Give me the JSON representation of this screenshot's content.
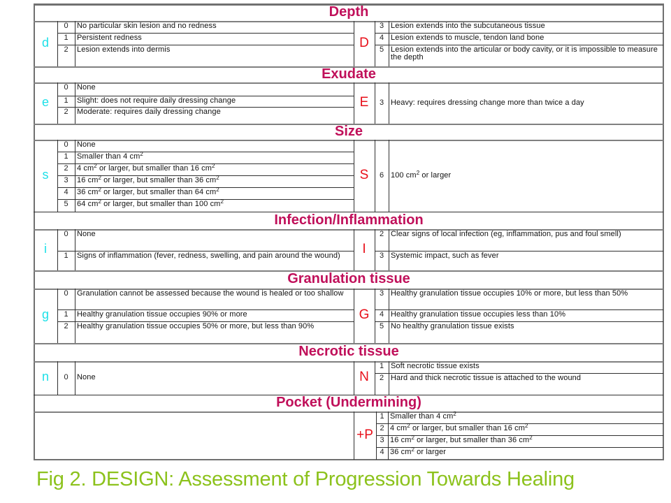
{
  "sections": {
    "depth": {
      "title": "Depth",
      "low_letter": "d",
      "high_letter": "D",
      "low_items": [
        {
          "score": "0",
          "text": "No particular skin lesion and no redness"
        },
        {
          "score": "1",
          "text": "Persistent redness"
        },
        {
          "score": "2",
          "text": "Lesion extends into dermis"
        }
      ],
      "high_items": [
        {
          "score": "3",
          "text": "Lesion extends into the subcutaneous tissue"
        },
        {
          "score": "4",
          "text": "Lesion extends to muscle, tendon land bone"
        },
        {
          "score": "5",
          "text": "Lesion extends into the articular or body cavity, or it is impossible to measure the depth"
        }
      ]
    },
    "exudate": {
      "title": "Exudate",
      "low_letter": "e",
      "high_letter": "E",
      "low_items": [
        {
          "score": "0",
          "text": "None"
        },
        {
          "score": "1",
          "text": "Slight: does not require daily dressing change"
        },
        {
          "score": "2",
          "text": "Moderate: requires daily dressing change"
        }
      ],
      "high_items": [
        {
          "score": "3",
          "text": "Heavy: requires dressing change more than twice a day"
        }
      ]
    },
    "size": {
      "title": "Size",
      "low_letter": "s",
      "high_letter": "S",
      "low_items": [
        {
          "score": "0",
          "text": "None"
        },
        {
          "score": "1",
          "text": "Smaller than 4 cm",
          "sup": "2"
        },
        {
          "score": "2",
          "text": "4 cm² or larger, but smaller than 16 cm²"
        },
        {
          "score": "3",
          "text": "16 cm² or larger, but smaller than 36 cm²"
        },
        {
          "score": "4",
          "text": "36 cm² or larger, but smaller than 64 cm²"
        },
        {
          "score": "5",
          "text": "64 cm² or larger, but smaller than 100 cm²"
        }
      ],
      "high_items": [
        {
          "score": "6",
          "text": "100 cm² or larger"
        }
      ]
    },
    "infection": {
      "title": "Infection/Inflammation",
      "low_letter": "i",
      "high_letter": "I",
      "low_items": [
        {
          "score": "0",
          "text": "None"
        },
        {
          "score": "1",
          "text": "Signs of inflammation (fever, redness, swelling, and pain around the wound)"
        }
      ],
      "high_items": [
        {
          "score": "2",
          "text": "Clear signs of local infection (eg, inflammation, pus and foul smell)"
        },
        {
          "score": "3",
          "text": "Systemic impact, such as fever"
        }
      ]
    },
    "granulation": {
      "title": "Granulation tissue",
      "low_letter": "g",
      "high_letter": "G",
      "low_items": [
        {
          "score": "0",
          "text": "Granulation cannot be assessed because the wound is healed or too shallow"
        },
        {
          "score": "1",
          "text": "Healthy granulation tissue occupies 90% or more"
        },
        {
          "score": "2",
          "text": "Healthy granulation tissue occupies 50% or more, but less than 90%"
        }
      ],
      "high_items": [
        {
          "score": "3",
          "text": "Healthy granulation tissue occupies 10% or more, but less than 50%"
        },
        {
          "score": "4",
          "text": "Healthy granulation tissue occupies less than 10%"
        },
        {
          "score": "5",
          "text": "No healthy granulation tissue exists"
        }
      ]
    },
    "necrotic": {
      "title": "Necrotic tissue",
      "low_letter": "n",
      "high_letter": "N",
      "low_items": [
        {
          "score": "0",
          "text": "None"
        }
      ],
      "high_items": [
        {
          "score": "1",
          "text": "Soft necrotic tissue exists"
        },
        {
          "score": "2",
          "text": "Hard and thick necrotic tissue is attached to the wound"
        }
      ]
    },
    "pocket": {
      "title": "Pocket (Undermining)",
      "high_letter": "+P",
      "high_items": [
        {
          "score": "1",
          "text": "Smaller than 4 cm²"
        },
        {
          "score": "2",
          "text": "4 cm² or larger, but smaller than 16 cm²"
        },
        {
          "score": "3",
          "text": "16 cm² or larger, but smaller than  36 cm²"
        },
        {
          "score": "4",
          "text": "36 cm² or larger"
        }
      ]
    }
  },
  "caption": "Fig 2. DESIGN: Assessment of Progression Towards Healing",
  "colors": {
    "section_title": "#c0105a",
    "low_letter": "#1ee0e8",
    "high_letter": "#e8101a",
    "caption": "#8cc21c"
  }
}
